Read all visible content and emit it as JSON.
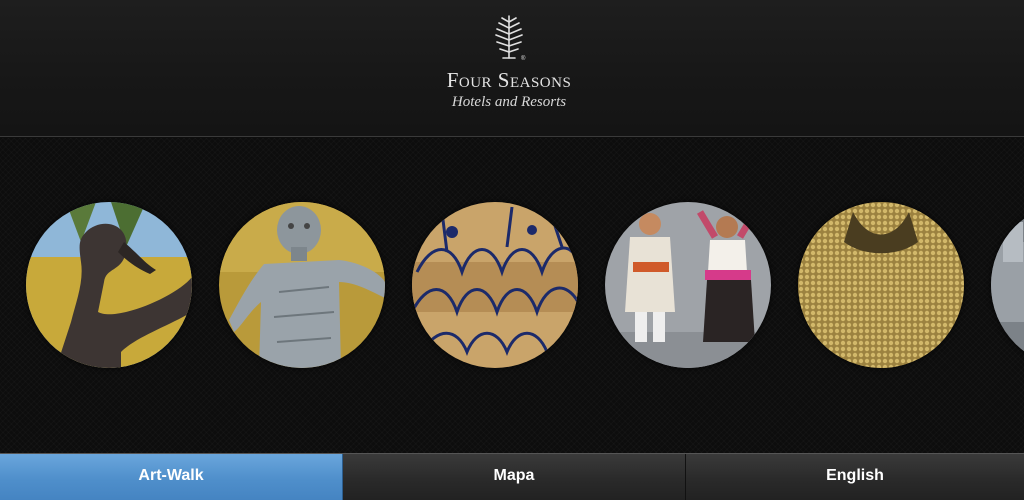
{
  "header": {
    "logo_icon": "tree-logo-icon",
    "brand_name": "Four Seasons",
    "brand_tagline": "Hotels and Resorts"
  },
  "gallery": {
    "items": [
      {
        "subject": "dancer-sculpture-icon"
      },
      {
        "subject": "metal-figure-sculpture-icon"
      },
      {
        "subject": "abstract-mural-icon"
      },
      {
        "subject": "folk-doll-figures-icon"
      },
      {
        "subject": "golden-textile-icon"
      },
      {
        "subject": "partial-artwork-icon"
      }
    ]
  },
  "tabs": [
    {
      "label": "Art-Walk",
      "active": true
    },
    {
      "label": "Mapa",
      "active": false
    },
    {
      "label": "English",
      "active": false
    }
  ],
  "colors": {
    "accent": "#4f8fcb",
    "background": "#0e0e0e",
    "header": "#1a1a1a"
  }
}
